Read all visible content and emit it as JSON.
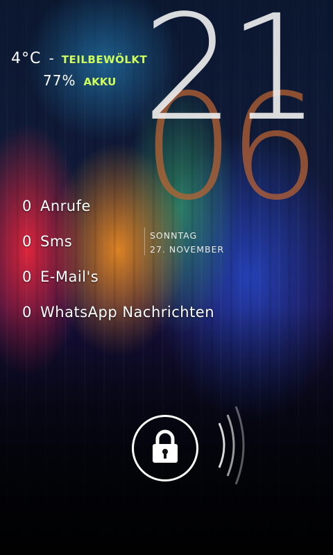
{
  "weather": {
    "temperature": "4°C",
    "separator": "-",
    "condition": "TEILBEWÖLKT"
  },
  "battery": {
    "percent": "77%",
    "label": "AKKU"
  },
  "clock": {
    "hour": "21",
    "minute": "06"
  },
  "date": {
    "weekday": "SONNTAG",
    "day_month": "27. NOVEMBER"
  },
  "notifications": [
    {
      "count": "0",
      "label": "Anrufe"
    },
    {
      "count": "0",
      "label": "Sms"
    },
    {
      "count": "0",
      "label": "E-Mail's"
    },
    {
      "count": "0",
      "label": "WhatsApp Nachrichten"
    }
  ],
  "lock": {
    "icon": "padlock-icon",
    "swipe_hint_icon": "swipe-arcs-icon"
  },
  "colors": {
    "accent_green": "#cfff5a",
    "minute_color": "#be6432",
    "hour_color": "#ebebeb"
  }
}
